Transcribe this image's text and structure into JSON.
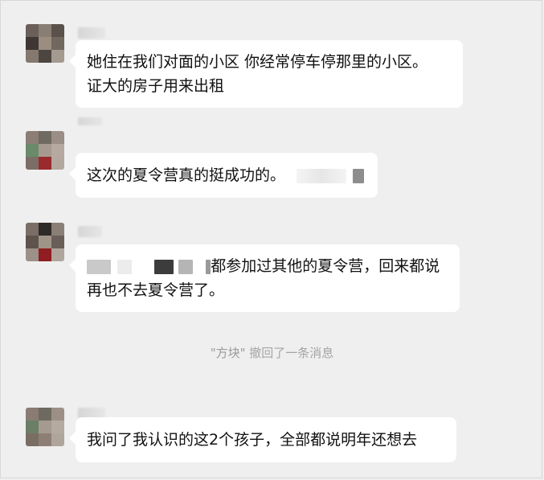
{
  "messages": [
    {
      "lines": [
        "她住在我们对面的小区 你经常停车停那里的小区。",
        "证大的房子用来出租"
      ]
    },
    {
      "lines": [
        "这次的夏令营真的挺成功的。"
      ]
    },
    {
      "line1_suffix": "都参加过其他的夏令营，回来都说",
      "line2": "再也不去夏令营了。"
    },
    {
      "lines": [
        "我问了我认识的这2个孩子，全部都说明年还想去"
      ]
    }
  ],
  "recall_notice": {
    "name": "\"方块\"",
    "text": " 撤回了一条消息"
  },
  "colors": {
    "background": "#efefef",
    "bubble": "#ffffff",
    "text": "#111111",
    "recall_text": "#a5a5a5"
  }
}
